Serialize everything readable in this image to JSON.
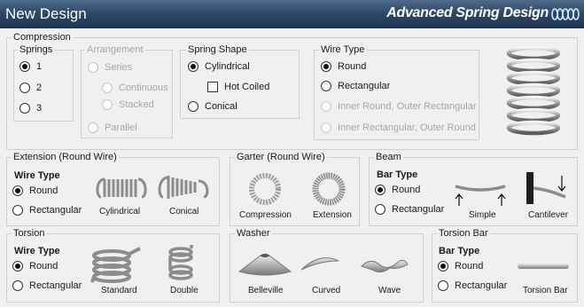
{
  "app": {
    "title": "New Design",
    "brand": "Advanced Spring Design"
  },
  "compression": {
    "label": "Compression",
    "springs": {
      "label": "Springs",
      "options": [
        "1",
        "2",
        "3"
      ],
      "selected": "1"
    },
    "arrangement": {
      "label": "Arrangement",
      "series": "Series",
      "continuous": "Continuous",
      "stacked": "Stacked",
      "parallel": "Parallel"
    },
    "shape": {
      "label": "Spring Shape",
      "cylindrical": "Cylindrical",
      "hot_coiled": "Hot Coiled",
      "conical": "Conical",
      "selected": "Cylindrical"
    },
    "wire": {
      "label": "Wire Type",
      "round": "Round",
      "rectangular": "Rectangular",
      "inner_round": "Inner Round, Outer Rectangular",
      "inner_rect": "Inner Rectangular, Outer Round",
      "selected": "Round"
    }
  },
  "extension": {
    "label": "Extension (Round Wire)",
    "wire_type": "Wire Type",
    "round": "Round",
    "rectangular": "Rectangular",
    "cylindrical": "Cylindrical",
    "conical": "Conical"
  },
  "garter": {
    "label": "Garter (Round Wire)",
    "compression": "Compression",
    "extension": "Extension"
  },
  "beam": {
    "label": "Beam",
    "bar_type": "Bar Type",
    "round": "Round",
    "rectangular": "Rectangular",
    "simple": "Simple",
    "cantilever": "Cantilever"
  },
  "torsion": {
    "label": "Torsion",
    "wire_type": "Wire Type",
    "round": "Round",
    "rectangular": "Rectangular",
    "standard": "Standard",
    "double": "Double"
  },
  "washer": {
    "label": "Washer",
    "belleville": "Belleville",
    "curved": "Curved",
    "wave": "Wave"
  },
  "torsion_bar": {
    "label": "Torsion Bar",
    "bar_type": "Bar Type",
    "round": "Round",
    "rectangular": "Rectangular",
    "caption": "Torsion Bar"
  }
}
